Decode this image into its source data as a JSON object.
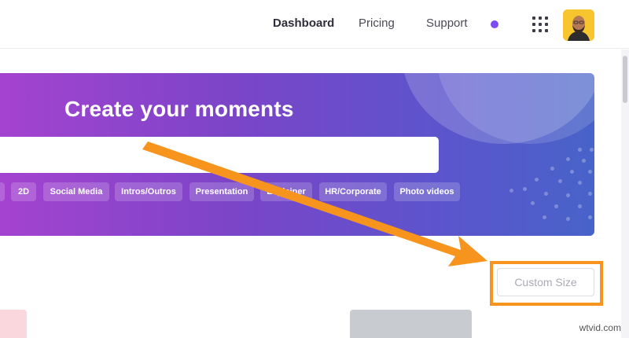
{
  "header": {
    "nav": [
      {
        "label": "Dashboard",
        "active": true
      },
      {
        "label": "Pricing",
        "active": false
      },
      {
        "label": "Support",
        "active": false
      }
    ],
    "status_dot_color": "#7b4cf0",
    "apps_icon": "grid-icon",
    "avatar_icon": "user-avatar"
  },
  "banner": {
    "title": "Create your moments",
    "search": {
      "value": "",
      "placeholder": ""
    },
    "tags": [
      "2D",
      "Social Media",
      "Intros/Outros",
      "Presentation",
      "Explainer",
      "HR/Corporate",
      "Photo videos"
    ],
    "gradient": [
      "#a443d0",
      "#4863c9"
    ]
  },
  "custom_size": {
    "label": "Custom Size",
    "highlight_color": "#f7941d"
  },
  "watermark": "wtvid.com"
}
